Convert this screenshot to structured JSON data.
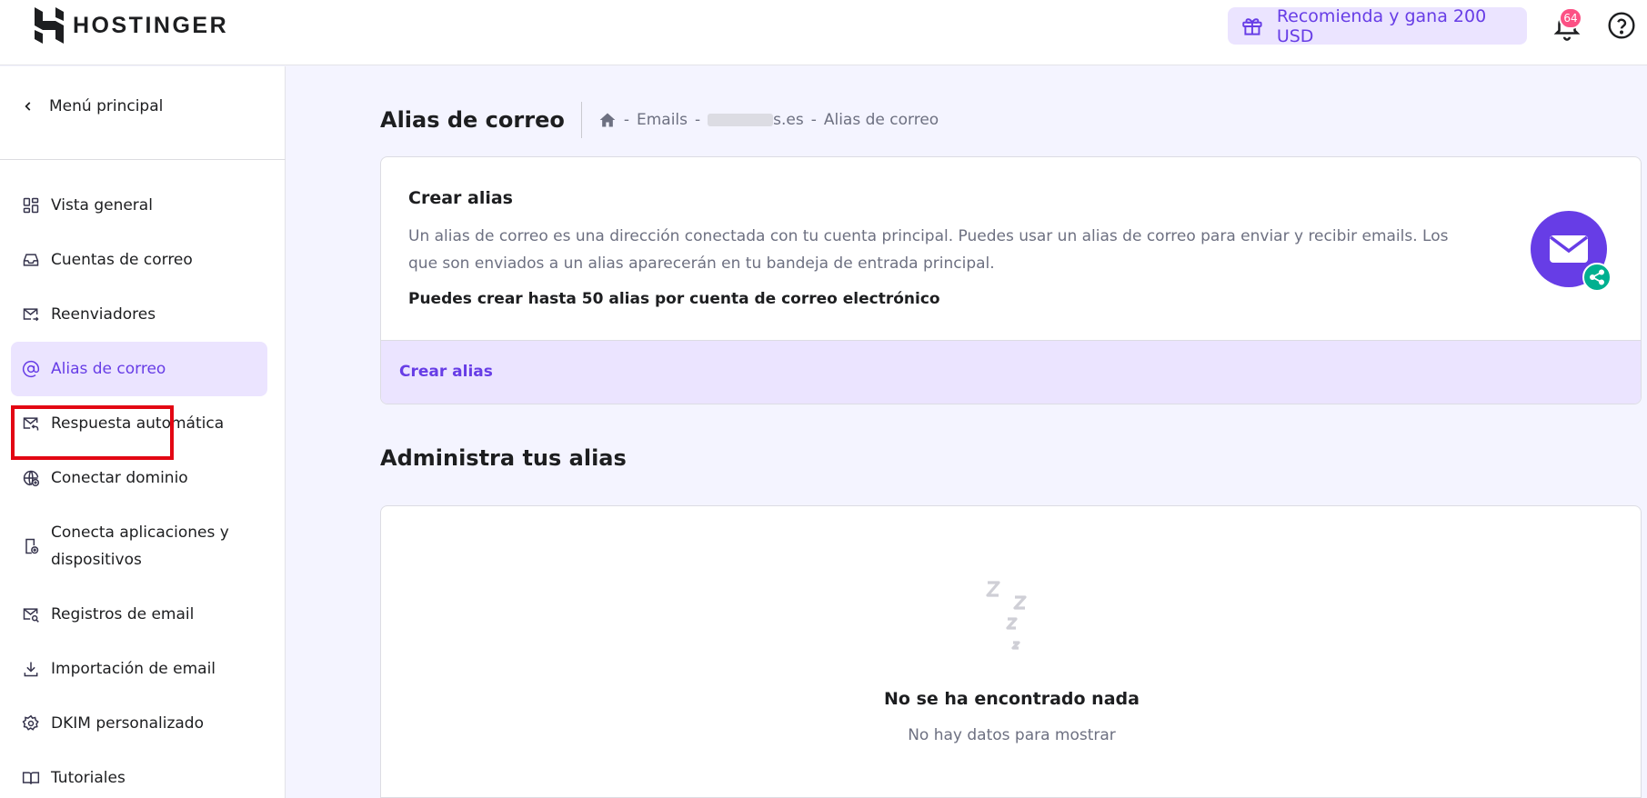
{
  "header": {
    "logo_text": "HOSTINGER",
    "refer_label": "Recomienda y gana 200 USD",
    "notification_count": "64"
  },
  "sidebar": {
    "back_label": "Menú principal",
    "items": [
      {
        "label": "Vista general",
        "icon": "grid-icon"
      },
      {
        "label": "Cuentas de correo",
        "icon": "inbox-icon"
      },
      {
        "label": "Reenviadores",
        "icon": "forward-mail-icon"
      },
      {
        "label": "Alias de correo",
        "icon": "at-icon",
        "active": true
      },
      {
        "label": "Respuesta automática",
        "icon": "auto-reply-icon"
      },
      {
        "label": "Conectar dominio",
        "icon": "globe-plus-icon"
      },
      {
        "label": "Conecta aplicaciones y dispositivos",
        "icon": "device-plus-icon"
      },
      {
        "label": "Registros de email",
        "icon": "mail-search-icon"
      },
      {
        "label": "Importación de email",
        "icon": "download-icon"
      },
      {
        "label": "DKIM personalizado",
        "icon": "gear-icon"
      },
      {
        "label": "Tutoriales",
        "icon": "book-icon"
      }
    ]
  },
  "page": {
    "title": "Alias de correo",
    "breadcrumb": {
      "emails": "Emails",
      "domain_suffix": "s.es",
      "current": "Alias de correo",
      "separator": "-"
    }
  },
  "create_card": {
    "title": "Crear alias",
    "description": "Un alias de correo es una dirección conectada con tu cuenta principal. Puedes usar un alias de correo para enviar y recibir emails. Los que son enviados a un alias aparecerán en tu bandeja de entrada principal.",
    "note": "Puedes crear hasta 50 alias por cuenta de correo electrónico",
    "action_label": "Crear alias"
  },
  "manage": {
    "title": "Administra tus alias",
    "empty_title": "No se ha encontrado nada",
    "empty_subtitle": "No hay datos para mostrar"
  },
  "colors": {
    "accent": "#673de6",
    "accent_light": "#ebe4ff",
    "badge": "#fc5185",
    "share": "#00b090",
    "highlight": "#e30613"
  }
}
